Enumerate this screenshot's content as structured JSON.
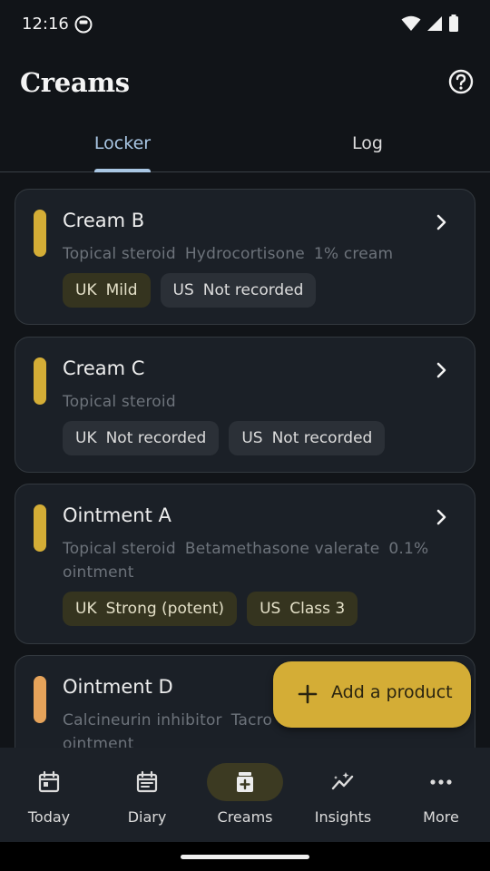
{
  "status_bar": {
    "time": "12:16"
  },
  "app_bar": {
    "title": "Creams"
  },
  "tabs": [
    {
      "label": "Locker"
    },
    {
      "label": "Log"
    }
  ],
  "products": [
    {
      "name": "Cream B",
      "details": [
        "Topical steroid",
        "Hydrocortisone",
        "1% cream"
      ],
      "bar_color": "#d4ad36",
      "uk": {
        "key": "UK",
        "value": "Mild"
      },
      "us": {
        "key": "US",
        "value": "Not recorded"
      }
    },
    {
      "name": "Cream C",
      "details": [
        "Topical steroid"
      ],
      "bar_color": "#d4ad36",
      "uk": {
        "key": "UK",
        "value": "Not recorded"
      },
      "us": {
        "key": "US",
        "value": "Not recorded"
      }
    },
    {
      "name": "Ointment A",
      "details": [
        "Topical steroid",
        "Betamethasone valerate",
        "0.1%",
        "ointment"
      ],
      "bar_color": "#d4ad36",
      "uk": {
        "key": "UK",
        "value": "Strong (potent)"
      },
      "us": {
        "key": "US",
        "value": "Class 3"
      }
    },
    {
      "name": "Ointment D",
      "details": [
        "Calcineurin inhibitor",
        "Tacro",
        "ointment"
      ],
      "bar_color": "#e6a35a"
    }
  ],
  "fab": {
    "label": "Add a product"
  },
  "bottom_nav": [
    {
      "label": "Today",
      "icon": "calendar-icon"
    },
    {
      "label": "Diary",
      "icon": "diary-icon"
    },
    {
      "label": "Creams",
      "icon": "cream-jar-icon",
      "active": true
    },
    {
      "label": "Insights",
      "icon": "insights-icon"
    },
    {
      "label": "More",
      "icon": "more-icon"
    }
  ],
  "colors": {
    "accent_tab": "#a9c6e3",
    "fab": "#d4ad36",
    "background": "#111418",
    "card": "#1b2027"
  }
}
